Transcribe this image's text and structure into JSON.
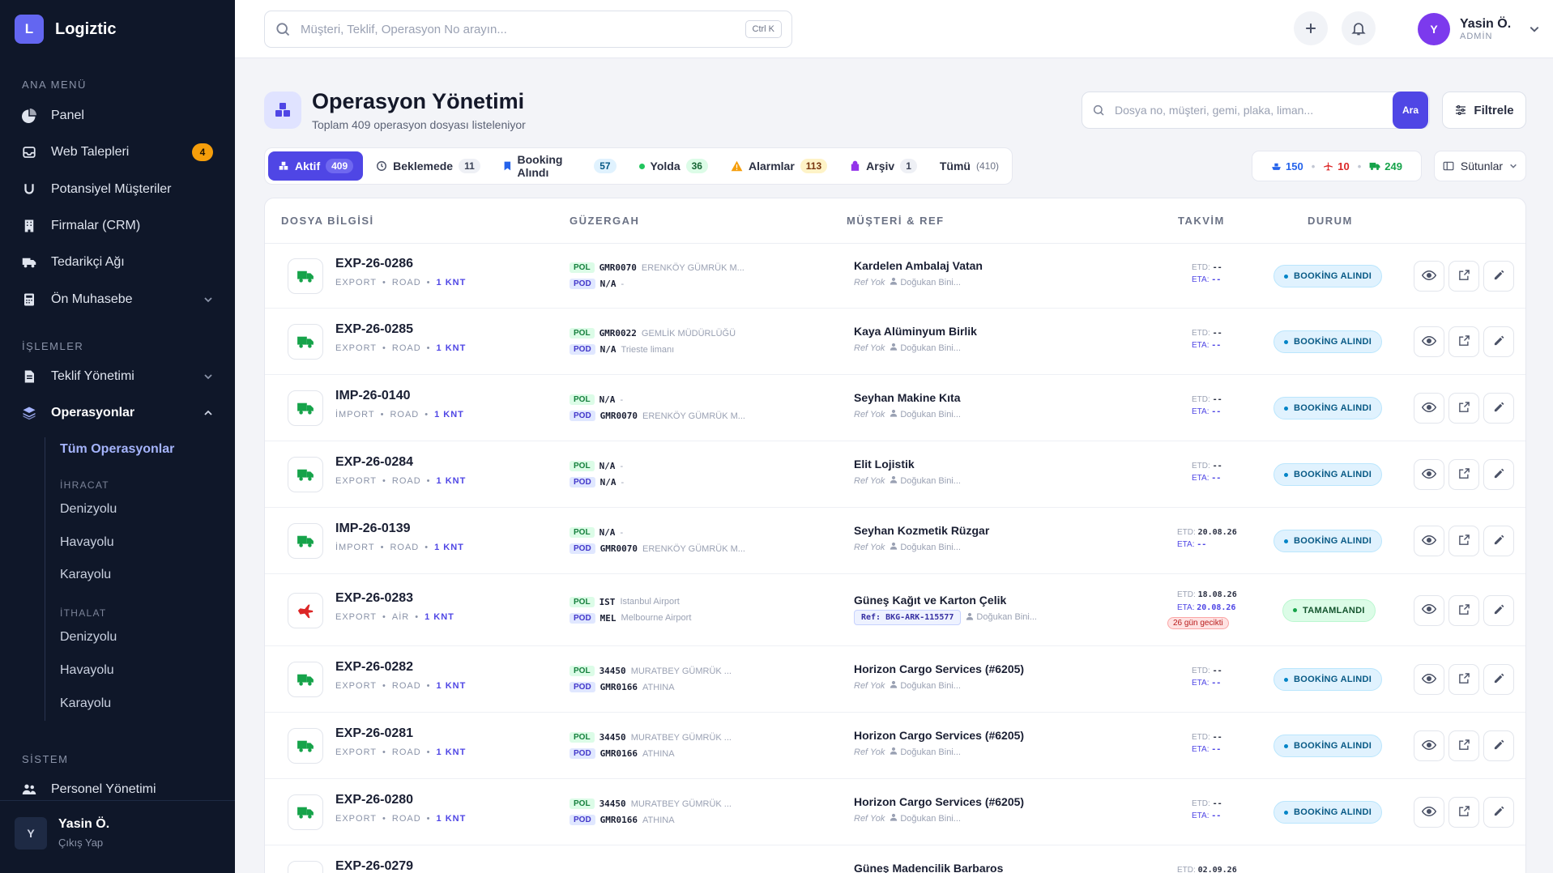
{
  "app": {
    "logo_letter": "L",
    "name": "Logiztic"
  },
  "sidebar": {
    "main_title": "ANA MENÜ",
    "main_items": [
      {
        "label": "Panel",
        "icon": "pie-chart-icon"
      },
      {
        "label": "Web Talepleri",
        "icon": "inbox-icon",
        "badge": "4"
      },
      {
        "label": "Potansiyel Müşteriler",
        "icon": "magnet-icon"
      },
      {
        "label": "Firmalar (CRM)",
        "icon": "building-icon"
      },
      {
        "label": "Tedarikçi Ağı",
        "icon": "truck-icon"
      },
      {
        "label": "Ön Muhasebe",
        "icon": "calculator-icon"
      }
    ],
    "ops_title": "İŞLEMLER",
    "ops_items": [
      {
        "label": "Teklif Yönetimi",
        "icon": "file-icon"
      },
      {
        "label": "Operasyonlar",
        "icon": "layers-icon"
      }
    ],
    "sub_all": "Tüm Operasyonlar",
    "export_title": "İHRACAT",
    "export_items": [
      "Denizyolu",
      "Havayolu",
      "Karayolu"
    ],
    "import_title": "İTHALAT",
    "import_items": [
      "Denizyolu",
      "Havayolu",
      "Karayolu"
    ],
    "system_title": "SİSTEM",
    "system_items": [
      {
        "label": "Personel Yönetimi",
        "icon": "users-icon"
      }
    ],
    "footer": {
      "avatar": "Y",
      "name": "Yasin Ö.",
      "action": "Çıkış Yap"
    }
  },
  "topbar": {
    "search_placeholder": "Müşteri, Teklif, Operasyon No arayın...",
    "shortcut": "Ctrl K",
    "user": {
      "avatar": "Y",
      "name": "Yasin Ö.",
      "role": "ADMİN"
    }
  },
  "header": {
    "title": "Operasyon Yönetimi",
    "subtitle": "Toplam 409 operasyon dosyası listeleniyor",
    "search_placeholder": "Dosya no, müşteri, gemi, plaka, liman...",
    "search_button": "Ara",
    "filter_button": "Filtrele",
    "columns_button": "Sütunlar"
  },
  "tabs": [
    {
      "label": "Aktif",
      "count": "409"
    },
    {
      "label": "Beklemede",
      "count": "11"
    },
    {
      "label": "Booking Alındı",
      "count": "57"
    },
    {
      "label": "Yolda",
      "count": "36"
    },
    {
      "label": "Alarmlar",
      "count": "113"
    },
    {
      "label": "Arşiv",
      "count": "1"
    },
    {
      "label": "Tümü",
      "count": "(410)"
    }
  ],
  "summary": {
    "sea": "150",
    "air": "10",
    "road": "249"
  },
  "colors": {
    "accent": "#4f46e5",
    "sea": "#2563eb",
    "air": "#dc2626",
    "road": "#16a34a"
  },
  "table": {
    "headers": [
      "DOSYA BİLGİSİ",
      "GÜZERGAH",
      "MÜŞTERİ & REF",
      "TAKVİM",
      "DURUM"
    ],
    "rows": [
      {
        "code": "EXP-26-0286",
        "dir": "EXPORT",
        "mode": "ROAD",
        "qty": "1 KNT",
        "pol_tag": "POL",
        "pol_code": "GMR0070",
        "pol_name": "ERENKÖY GÜMRÜK M...",
        "pod_tag": "POD",
        "pod_code": "N/A",
        "pod_name": "-",
        "customer": "Kardelen Ambalaj Vatan",
        "ref": "Ref Yok",
        "agent": "Doğukan Bini...",
        "etd_label": "ETD:",
        "etd": "--",
        "eta_label": "ETA:",
        "eta": "--",
        "late": "",
        "status": "BOOKİNG ALINDI"
      },
      {
        "code": "EXP-26-0285",
        "dir": "EXPORT",
        "mode": "ROAD",
        "qty": "1 KNT",
        "pol_tag": "POL",
        "pol_code": "GMR0022",
        "pol_name": "GEMLİK MÜDÜRLÜĞÜ",
        "pod_tag": "POD",
        "pod_code": "N/A",
        "pod_name": "Trieste limanı",
        "customer": "Kaya Alüminyum Birlik",
        "ref": "Ref Yok",
        "agent": "Doğukan Bini...",
        "etd_label": "ETD:",
        "etd": "--",
        "eta_label": "ETA:",
        "eta": "--",
        "late": "",
        "status": "BOOKİNG ALINDI"
      },
      {
        "code": "IMP-26-0140",
        "dir": "İMPORT",
        "mode": "ROAD",
        "qty": "1 KNT",
        "pol_tag": "POL",
        "pol_code": "N/A",
        "pol_name": "-",
        "pod_tag": "POD",
        "pod_code": "GMR0070",
        "pod_name": "ERENKÖY GÜMRÜK M...",
        "customer": "Seyhan Makine Kıta",
        "ref": "Ref Yok",
        "agent": "Doğukan Bini...",
        "etd_label": "ETD:",
        "etd": "--",
        "eta_label": "ETA:",
        "eta": "--",
        "late": "",
        "status": "BOOKİNG ALINDI"
      },
      {
        "code": "EXP-26-0284",
        "dir": "EXPORT",
        "mode": "ROAD",
        "qty": "1 KNT",
        "pol_tag": "POL",
        "pol_code": "N/A",
        "pol_name": "-",
        "pod_tag": "POD",
        "pod_code": "N/A",
        "pod_name": "-",
        "customer": "Elit Lojistik",
        "ref": "Ref Yok",
        "agent": "Doğukan Bini...",
        "etd_label": "ETD:",
        "etd": "--",
        "eta_label": "ETA:",
        "eta": "--",
        "late": "",
        "status": "BOOKİNG ALINDI"
      },
      {
        "code": "IMP-26-0139",
        "dir": "İMPORT",
        "mode": "ROAD",
        "qty": "1 KNT",
        "pol_tag": "POL",
        "pol_code": "N/A",
        "pol_name": "-",
        "pod_tag": "POD",
        "pod_code": "GMR0070",
        "pod_name": "ERENKÖY GÜMRÜK M...",
        "customer": "Seyhan Kozmetik Rüzgar",
        "ref": "Ref Yok",
        "agent": "Doğukan Bini...",
        "etd_label": "ETD:",
        "etd": "20.08.26",
        "eta_label": "ETA:",
        "eta": "--",
        "late": "",
        "status": "BOOKİNG ALINDI"
      },
      {
        "code": "EXP-26-0283",
        "dir": "EXPORT",
        "mode": "AİR",
        "qty": "1 KNT",
        "pol_tag": "POL",
        "pol_code": "IST",
        "pol_name": "Istanbul Airport",
        "pod_tag": "POD",
        "pod_code": "MEL",
        "pod_name": "Melbourne Airport",
        "customer": "Güneş Kağıt ve Karton Çelik",
        "ref": "Ref: BKG-ARK-115577",
        "agent": "Doğukan Bini...",
        "etd_label": "ETD:",
        "etd": "18.08.26",
        "eta_label": "ETA:",
        "eta": "20.08.26",
        "late": "26 gün gecikti",
        "status": "TAMAMLANDI"
      },
      {
        "code": "EXP-26-0282",
        "dir": "EXPORT",
        "mode": "ROAD",
        "qty": "1 KNT",
        "pol_tag": "POL",
        "pol_code": "34450",
        "pol_name": "MURATBEY GÜMRÜK ...",
        "pod_tag": "POD",
        "pod_code": "GMR0166",
        "pod_name": "ATHINA",
        "customer": "Horizon Cargo Services (#6205)",
        "ref": "Ref Yok",
        "agent": "Doğukan Bini...",
        "etd_label": "ETD:",
        "etd": "--",
        "eta_label": "ETA:",
        "eta": "--",
        "late": "",
        "status": "BOOKİNG ALINDI"
      },
      {
        "code": "EXP-26-0281",
        "dir": "EXPORT",
        "mode": "ROAD",
        "qty": "1 KNT",
        "pol_tag": "POL",
        "pol_code": "34450",
        "pol_name": "MURATBEY GÜMRÜK ...",
        "pod_tag": "POD",
        "pod_code": "GMR0166",
        "pod_name": "ATHINA",
        "customer": "Horizon Cargo Services (#6205)",
        "ref": "Ref Yok",
        "agent": "Doğukan Bini...",
        "etd_label": "ETD:",
        "etd": "--",
        "eta_label": "ETA:",
        "eta": "--",
        "late": "",
        "status": "BOOKİNG ALINDI"
      },
      {
        "code": "EXP-26-0280",
        "dir": "EXPORT",
        "mode": "ROAD",
        "qty": "1 KNT",
        "pol_tag": "POL",
        "pol_code": "34450",
        "pol_name": "MURATBEY GÜMRÜK ...",
        "pod_tag": "POD",
        "pod_code": "GMR0166",
        "pod_name": "ATHINA",
        "customer": "Horizon Cargo Services (#6205)",
        "ref": "Ref Yok",
        "agent": "Doğukan Bini...",
        "etd_label": "ETD:",
        "etd": "--",
        "eta_label": "ETA:",
        "eta": "--",
        "late": "",
        "status": "BOOKİNG ALINDI"
      },
      {
        "code": "EXP-26-0279",
        "dir": "",
        "mode": "",
        "qty": "",
        "pol_tag": "",
        "pol_code": "",
        "pol_name": "",
        "pod_tag": "",
        "pod_code": "",
        "pod_name": "",
        "customer": "Güneş Madencilik Barbaros",
        "ref": "",
        "agent": "",
        "etd_label": "ETD:",
        "etd": "02.09.26",
        "eta_label": "",
        "eta": "",
        "late": "",
        "status": ""
      }
    ]
  }
}
